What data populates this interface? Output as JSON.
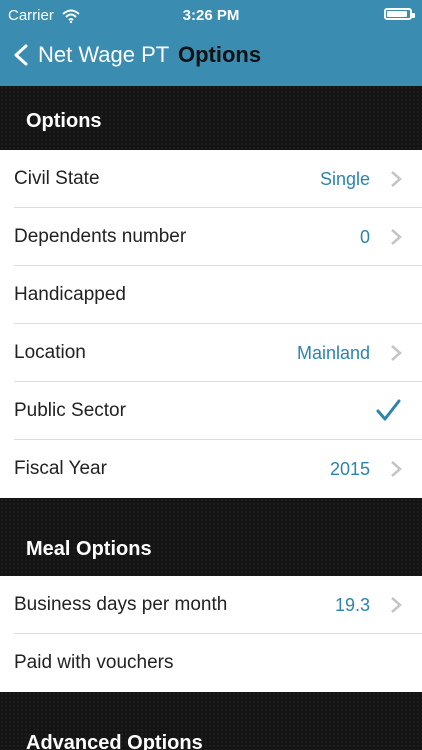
{
  "status_bar": {
    "carrier": "Carrier",
    "time": "3:26 PM"
  },
  "nav": {
    "back_label": "Net Wage PT",
    "title": "Options"
  },
  "sections": [
    {
      "header": "Options",
      "rows": [
        {
          "label": "Civil State",
          "value": "Single",
          "accessory": "chevron"
        },
        {
          "label": "Dependents number",
          "value": "0",
          "accessory": "chevron"
        },
        {
          "label": "Handicapped",
          "value": "",
          "accessory": "none"
        },
        {
          "label": "Location",
          "value": "Mainland",
          "accessory": "chevron"
        },
        {
          "label": "Public Sector",
          "value": "",
          "accessory": "checkmark"
        },
        {
          "label": "Fiscal Year",
          "value": "2015",
          "accessory": "chevron"
        }
      ]
    },
    {
      "header": "Meal Options",
      "rows": [
        {
          "label": "Business days per month",
          "value": "19.3",
          "accessory": "chevron"
        },
        {
          "label": "Paid with vouchers",
          "value": "",
          "accessory": "none"
        }
      ]
    },
    {
      "header": "Advanced Options"
    }
  ],
  "colors": {
    "nav_background": "#3a8cb0",
    "accent": "#2c84ad",
    "section_background": "#141414",
    "nav_title": "#111111"
  },
  "icons": {
    "wifi": "wifi-icon",
    "battery": "battery-icon",
    "back": "chevron-left-icon",
    "disclosure": "chevron-right-icon",
    "check": "checkmark-icon"
  }
}
